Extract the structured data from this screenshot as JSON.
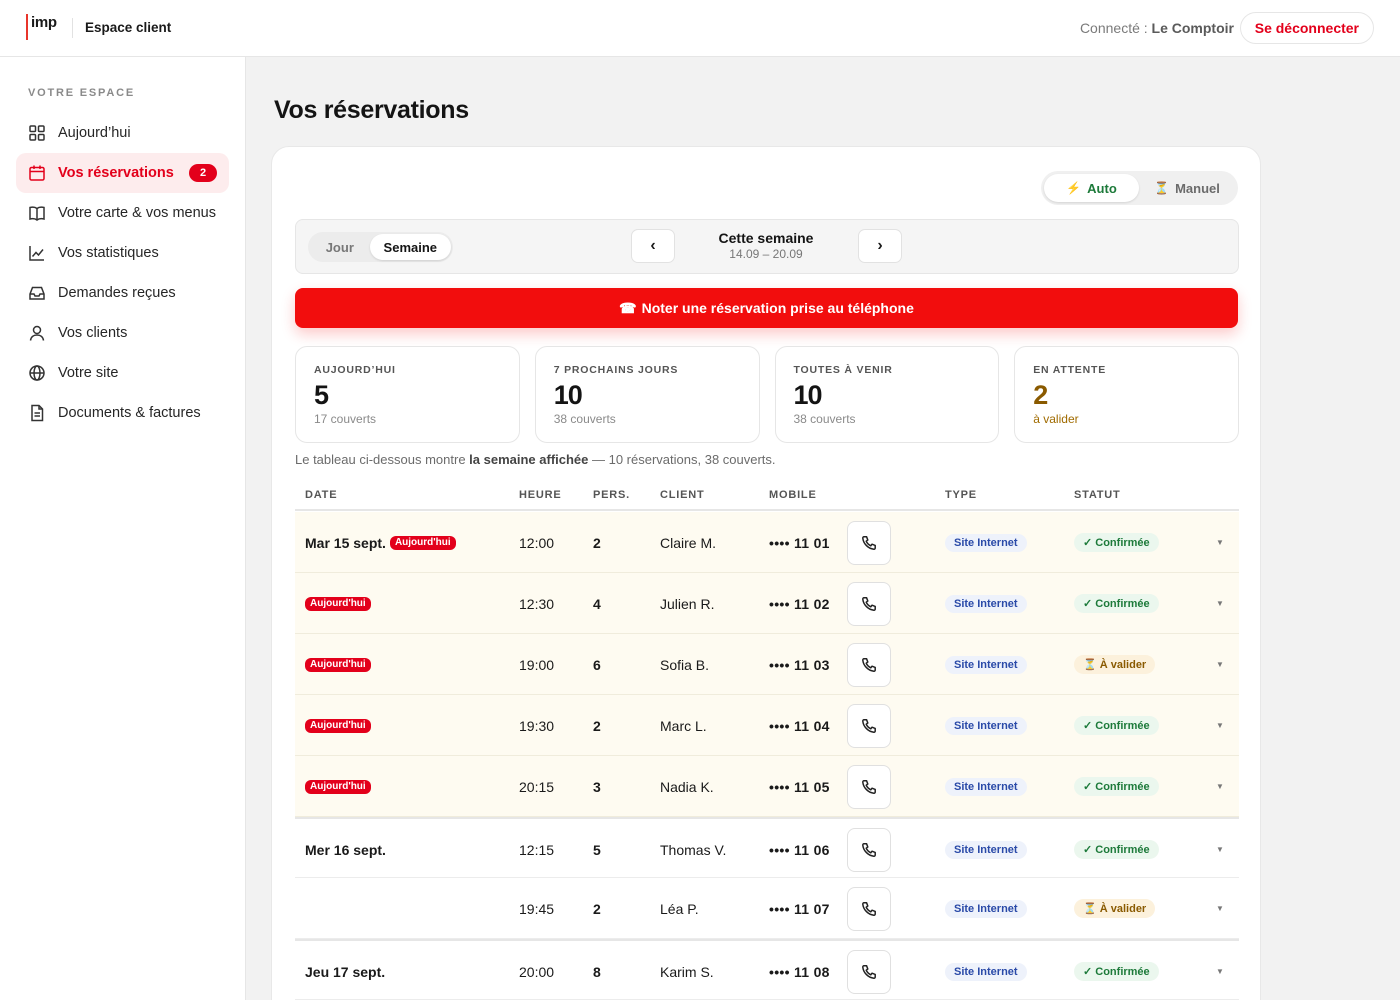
{
  "header": {
    "logo": "imp",
    "app_name": "Espace client",
    "connected_label": "Connecté :",
    "connected_user": "Le Comptoir",
    "logout_label": "Se déconnecter"
  },
  "sidebar": {
    "section_title": "VOTRE ESPACE",
    "items": [
      {
        "label": "Aujourd’hui",
        "icon": "grid-icon"
      },
      {
        "label": "Vos réservations",
        "icon": "calendar-icon",
        "badge": "2",
        "active": true
      },
      {
        "label": "Votre carte & vos menus",
        "icon": "book-icon"
      },
      {
        "label": "Vos statistiques",
        "icon": "chart-icon"
      },
      {
        "label": "Demandes reçues",
        "icon": "inbox-icon"
      },
      {
        "label": "Vos clients",
        "icon": "user-icon"
      },
      {
        "label": "Votre site",
        "icon": "globe-icon"
      },
      {
        "label": "Documents & factures",
        "icon": "document-icon"
      }
    ]
  },
  "main": {
    "title": "Vos réservations",
    "mode": {
      "auto": "Auto",
      "manual": "Manuel",
      "selected": "Auto"
    },
    "view": {
      "day": "Jour",
      "week": "Semaine",
      "selected": "Semaine"
    },
    "period": {
      "title": "Cette semaine",
      "range": "14.09 – 20.09",
      "prev": "‹",
      "next": "›"
    },
    "phone_cta": "Noter une réservation prise au téléphone",
    "stats": [
      {
        "label": "AUJOURD’HUI",
        "value": "5",
        "sub": "17 couverts"
      },
      {
        "label": "7 PROCHAINS JOURS",
        "value": "10",
        "sub": "38 couverts"
      },
      {
        "label": "TOUTES À VENIR",
        "value": "10",
        "sub": "38 couverts"
      },
      {
        "label": "EN ATTENTE",
        "value": "2",
        "sub": "à valider"
      }
    ],
    "caption": {
      "prefix": "Le tableau ci-dessous montre ",
      "bold": "la semaine affichée",
      "suffix": " — 10 réservations, 38 couverts."
    },
    "columns": [
      "DATE",
      "HEURE",
      "PERS.",
      "CLIENT",
      "MOBILE",
      "TYPE",
      "STATUT"
    ],
    "today_badge": "Aujourd'hui",
    "rows": [
      {
        "date": "Mar 15 sept.",
        "today": true,
        "time": "12:00",
        "pers": "2",
        "client": "Claire M.",
        "mobile": "•••• 11 01",
        "type": "Site Internet",
        "status": "✓ Confirmée",
        "status_kind": "ok"
      },
      {
        "date": "",
        "today": true,
        "time": "12:30",
        "pers": "4",
        "client": "Julien R.",
        "mobile": "•••• 11 02",
        "type": "Site Internet",
        "status": "✓ Confirmée",
        "status_kind": "ok"
      },
      {
        "date": "",
        "today": true,
        "time": "19:00",
        "pers": "6",
        "client": "Sofia B.",
        "mobile": "•••• 11 03",
        "type": "Site Internet",
        "status": "⏳ À valider",
        "status_kind": "pending"
      },
      {
        "date": "",
        "today": true,
        "time": "19:30",
        "pers": "2",
        "client": "Marc L.",
        "mobile": "•••• 11 04",
        "type": "Site Internet",
        "status": "✓ Confirmée",
        "status_kind": "ok"
      },
      {
        "date": "",
        "today": true,
        "time": "20:15",
        "pers": "3",
        "client": "Nadia K.",
        "mobile": "•••• 11 05",
        "type": "Site Internet",
        "status": "✓ Confirmée",
        "status_kind": "ok"
      },
      {
        "date": "Mer 16 sept.",
        "today": false,
        "time": "12:15",
        "pers": "5",
        "client": "Thomas V.",
        "mobile": "•••• 11 06",
        "type": "Site Internet",
        "status": "✓ Confirmée",
        "status_kind": "ok"
      },
      {
        "date": "",
        "today": false,
        "time": "19:45",
        "pers": "2",
        "client": "Léa P.",
        "mobile": "•••• 11 07",
        "type": "Site Internet",
        "status": "⏳ À valider",
        "status_kind": "pending"
      },
      {
        "date": "Jeu 17 sept.",
        "today": false,
        "time": "20:00",
        "pers": "8",
        "client": "Karim S.",
        "mobile": "•••• 11 08",
        "type": "Site Internet",
        "status": "✓ Confirmée",
        "status_kind": "ok"
      }
    ]
  },
  "colors": {
    "accent": "#e3001b",
    "cta": "#f20d0d",
    "ok": "#1d7a3a",
    "pending": "#8a5a00"
  }
}
